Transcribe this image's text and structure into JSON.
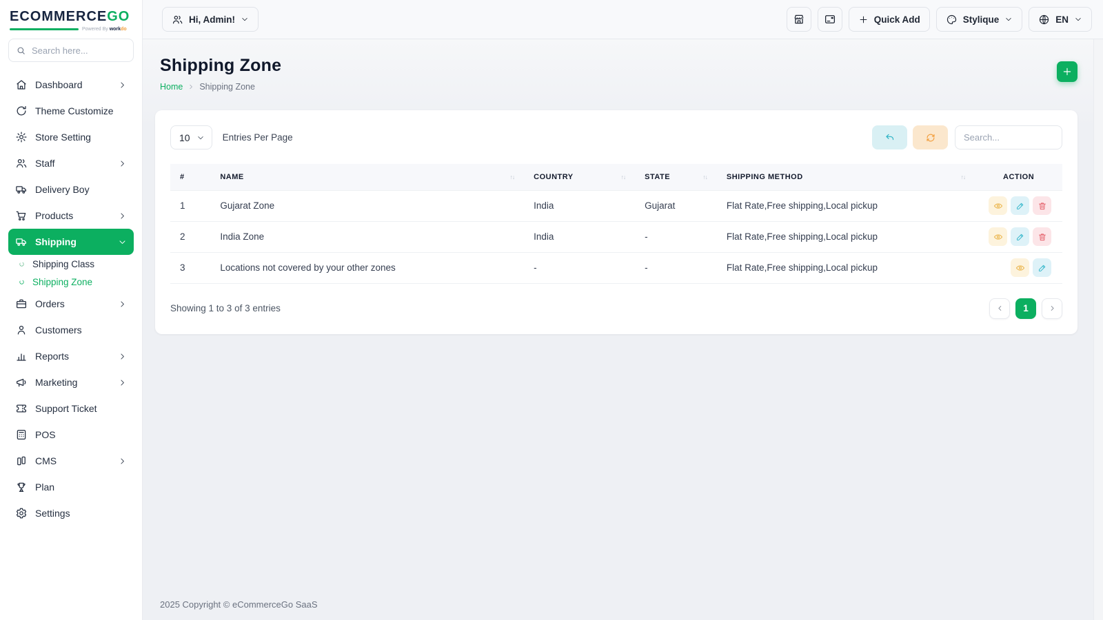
{
  "brand": {
    "logo_text": "ECOMMERCE",
    "logo_accent": "GO",
    "powered_prefix": "Powered By",
    "powered_brand_a": "work",
    "powered_brand_b": "do"
  },
  "topbar": {
    "greeting": "Hi, Admin!",
    "quick_add_label": "Quick Add",
    "theme_label": "Stylique",
    "language_label": "EN"
  },
  "sidebar": {
    "search_placeholder": "Search here...",
    "items": [
      {
        "label": "Dashboard",
        "icon": "home",
        "chevron": "right"
      },
      {
        "label": "Theme Customize",
        "icon": "rotate"
      },
      {
        "label": "Store Setting",
        "icon": "gear"
      },
      {
        "label": "Staff",
        "icon": "users",
        "chevron": "right"
      },
      {
        "label": "Delivery Boy",
        "icon": "truck"
      },
      {
        "label": "Products",
        "icon": "cart",
        "chevron": "right"
      },
      {
        "label": "Shipping",
        "icon": "truck",
        "chevron": "down",
        "active": true,
        "children": [
          {
            "label": "Shipping Class",
            "active": false
          },
          {
            "label": "Shipping Zone",
            "active": true
          }
        ]
      },
      {
        "label": "Orders",
        "icon": "briefcase",
        "chevron": "right"
      },
      {
        "label": "Customers",
        "icon": "person"
      },
      {
        "label": "Reports",
        "icon": "chart",
        "chevron": "right"
      },
      {
        "label": "Marketing",
        "icon": "megaphone",
        "chevron": "right"
      },
      {
        "label": "Support Ticket",
        "icon": "ticket"
      },
      {
        "label": "POS",
        "icon": "pos"
      },
      {
        "label": "CMS",
        "icon": "cms",
        "chevron": "right"
      },
      {
        "label": "Plan",
        "icon": "trophy"
      },
      {
        "label": "Settings",
        "icon": "settings"
      }
    ]
  },
  "page": {
    "title": "Shipping Zone",
    "breadcrumb": {
      "home": "Home",
      "current": "Shipping Zone"
    }
  },
  "controls": {
    "entries_value": "10",
    "entries_label": "Entries Per Page",
    "search_placeholder": "Search..."
  },
  "table": {
    "columns": [
      {
        "label": "#",
        "sortable": false
      },
      {
        "label": "NAME",
        "sortable": true
      },
      {
        "label": "COUNTRY",
        "sortable": true
      },
      {
        "label": "STATE",
        "sortable": true
      },
      {
        "label": "SHIPPING METHOD",
        "sortable": true
      },
      {
        "label": "ACTION",
        "sortable": false
      }
    ],
    "rows": [
      {
        "num": "1",
        "name": "Gujarat Zone",
        "country": "India",
        "state": "Gujarat",
        "method": "Flat Rate,Free shipping,Local pickup",
        "actions": [
          "view",
          "edit",
          "delete"
        ]
      },
      {
        "num": "2",
        "name": "India Zone",
        "country": "India",
        "state": "-",
        "method": "Flat Rate,Free shipping,Local pickup",
        "actions": [
          "view",
          "edit",
          "delete"
        ]
      },
      {
        "num": "3",
        "name": "Locations not covered by your other zones",
        "country": "-",
        "state": "-",
        "method": "Flat Rate,Free shipping,Local pickup",
        "actions": [
          "view",
          "edit"
        ]
      }
    ]
  },
  "table_footer": {
    "summary": "Showing 1 to 3 of 3 entries",
    "pages": [
      "1"
    ],
    "current_page": "1"
  },
  "footer": {
    "copyright": "2025 Copyright © eCommerceGo SaaS"
  },
  "colors": {
    "primary_green": "#0caf60",
    "view_accent": "#e9b041",
    "edit_accent": "#36b7cb",
    "delete_accent": "#e4606a",
    "undo_accent": "#2ab2c4",
    "refresh_accent": "#f29b38"
  }
}
